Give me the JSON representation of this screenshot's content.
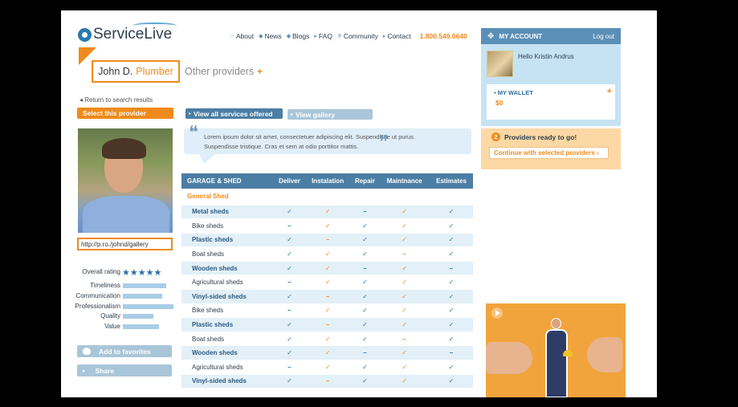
{
  "brand": {
    "name": "ServiceLive"
  },
  "nav": {
    "items": [
      "About",
      "News",
      "Blogs",
      "FAQ",
      "Community",
      "Contact"
    ],
    "phone": "1.800.549.0640"
  },
  "provider": {
    "name": "John D.",
    "role": "Plumber",
    "other_label": "Other providers",
    "other_icon": "plus-icon",
    "return_link": "◂ Return to search results",
    "select_button": "Select this provider",
    "gallery_url": "http://p.ro./johnd/gallery"
  },
  "ratings": {
    "overall_label": "Overall rating",
    "overall_stars": 5,
    "stars_text": "★★★★★",
    "items": [
      {
        "label": "Timeliness",
        "level": 0.85
      },
      {
        "label": "Communication",
        "level": 0.77
      },
      {
        "label": "Professionalism",
        "level": 1.0
      },
      {
        "label": "Quality",
        "level": 0.6
      },
      {
        "label": "Value",
        "level": 0.72
      }
    ]
  },
  "actions": {
    "favorites": "Add to favorites",
    "share": "Share"
  },
  "tabs": {
    "services": "View all services offered",
    "gallery": "View gallery"
  },
  "quote": {
    "text": "Lorem ipsum dolor sit amet, consectetuer adipiscing elit. Suspendisse ut purus. Suspendisse tristique. Cras et sem at odio porttitor mattis.",
    "open_mark": "❝",
    "close_mark": "❞"
  },
  "services_table": {
    "columns": [
      "GARAGE & SHED",
      "Deliver",
      "Instalation",
      "Repair",
      "Maintnance",
      "Estimates"
    ],
    "group_label": "General Shed",
    "rows": [
      {
        "name": "Metal sheds",
        "alt": true,
        "cells": [
          "✓b",
          "✓o",
          "–",
          "✓o",
          "✓b"
        ]
      },
      {
        "name": "Bike sheds",
        "alt": false,
        "cells": [
          "–",
          "✓o",
          "✓b",
          "✓o",
          "✓b"
        ]
      },
      {
        "name": "Plastic sheds",
        "alt": true,
        "cells": [
          "✓b",
          "–o",
          "✓b",
          "✓o",
          "✓b"
        ]
      },
      {
        "name": "Boat sheds",
        "alt": false,
        "cells": [
          "✓b",
          "✓o",
          "✓b",
          "–o",
          "✓b"
        ]
      },
      {
        "name": "Wooden sheds",
        "alt": true,
        "cells": [
          "✓b",
          "✓o",
          "–",
          "✓o",
          "–"
        ]
      },
      {
        "name": "Agricultural sheds",
        "alt": false,
        "cells": [
          "–",
          "✓o",
          "✓b",
          "✓o",
          "✓b"
        ]
      },
      {
        "name": "Vinyl-sided sheds",
        "alt": true,
        "cells": [
          "✓b",
          "–o",
          "✓b",
          "✓o",
          "✓b"
        ]
      },
      {
        "name": "Bike sheds",
        "alt": false,
        "cells": [
          "–",
          "✓o",
          "✓b",
          "✓o",
          "✓b"
        ]
      },
      {
        "name": "Plastic sheds",
        "alt": true,
        "cells": [
          "✓b",
          "–o",
          "✓b",
          "✓o",
          "✓b"
        ]
      },
      {
        "name": "Boat sheds",
        "alt": false,
        "cells": [
          "✓b",
          "✓o",
          "✓b",
          "–o",
          "✓b"
        ]
      },
      {
        "name": "Wooden sheds",
        "alt": true,
        "cells": [
          "✓b",
          "✓o",
          "–",
          "✓o",
          "–"
        ]
      },
      {
        "name": "Agricultural sheds",
        "alt": false,
        "cells": [
          "–",
          "✓o",
          "✓b",
          "✓o",
          "✓b"
        ]
      },
      {
        "name": "Vinyl-sided sheds",
        "alt": true,
        "cells": [
          "✓b",
          "–o",
          "✓b",
          "✓o",
          "✓b"
        ]
      }
    ]
  },
  "account": {
    "title": "MY ACCOUNT",
    "logout": "Log out",
    "greeting": "Hello Kristin Andrus",
    "wallet_label": "MY WALLET",
    "wallet_amount": "$0",
    "wallet_plus": "+"
  },
  "ready": {
    "count": "2",
    "label": "Providers ready to go!",
    "continue": "Continue with selected providers ›"
  },
  "colors": {
    "accent_orange": "#f08a1c",
    "primary_blue": "#4b7ea4",
    "light_blue": "#c6e3f3"
  }
}
